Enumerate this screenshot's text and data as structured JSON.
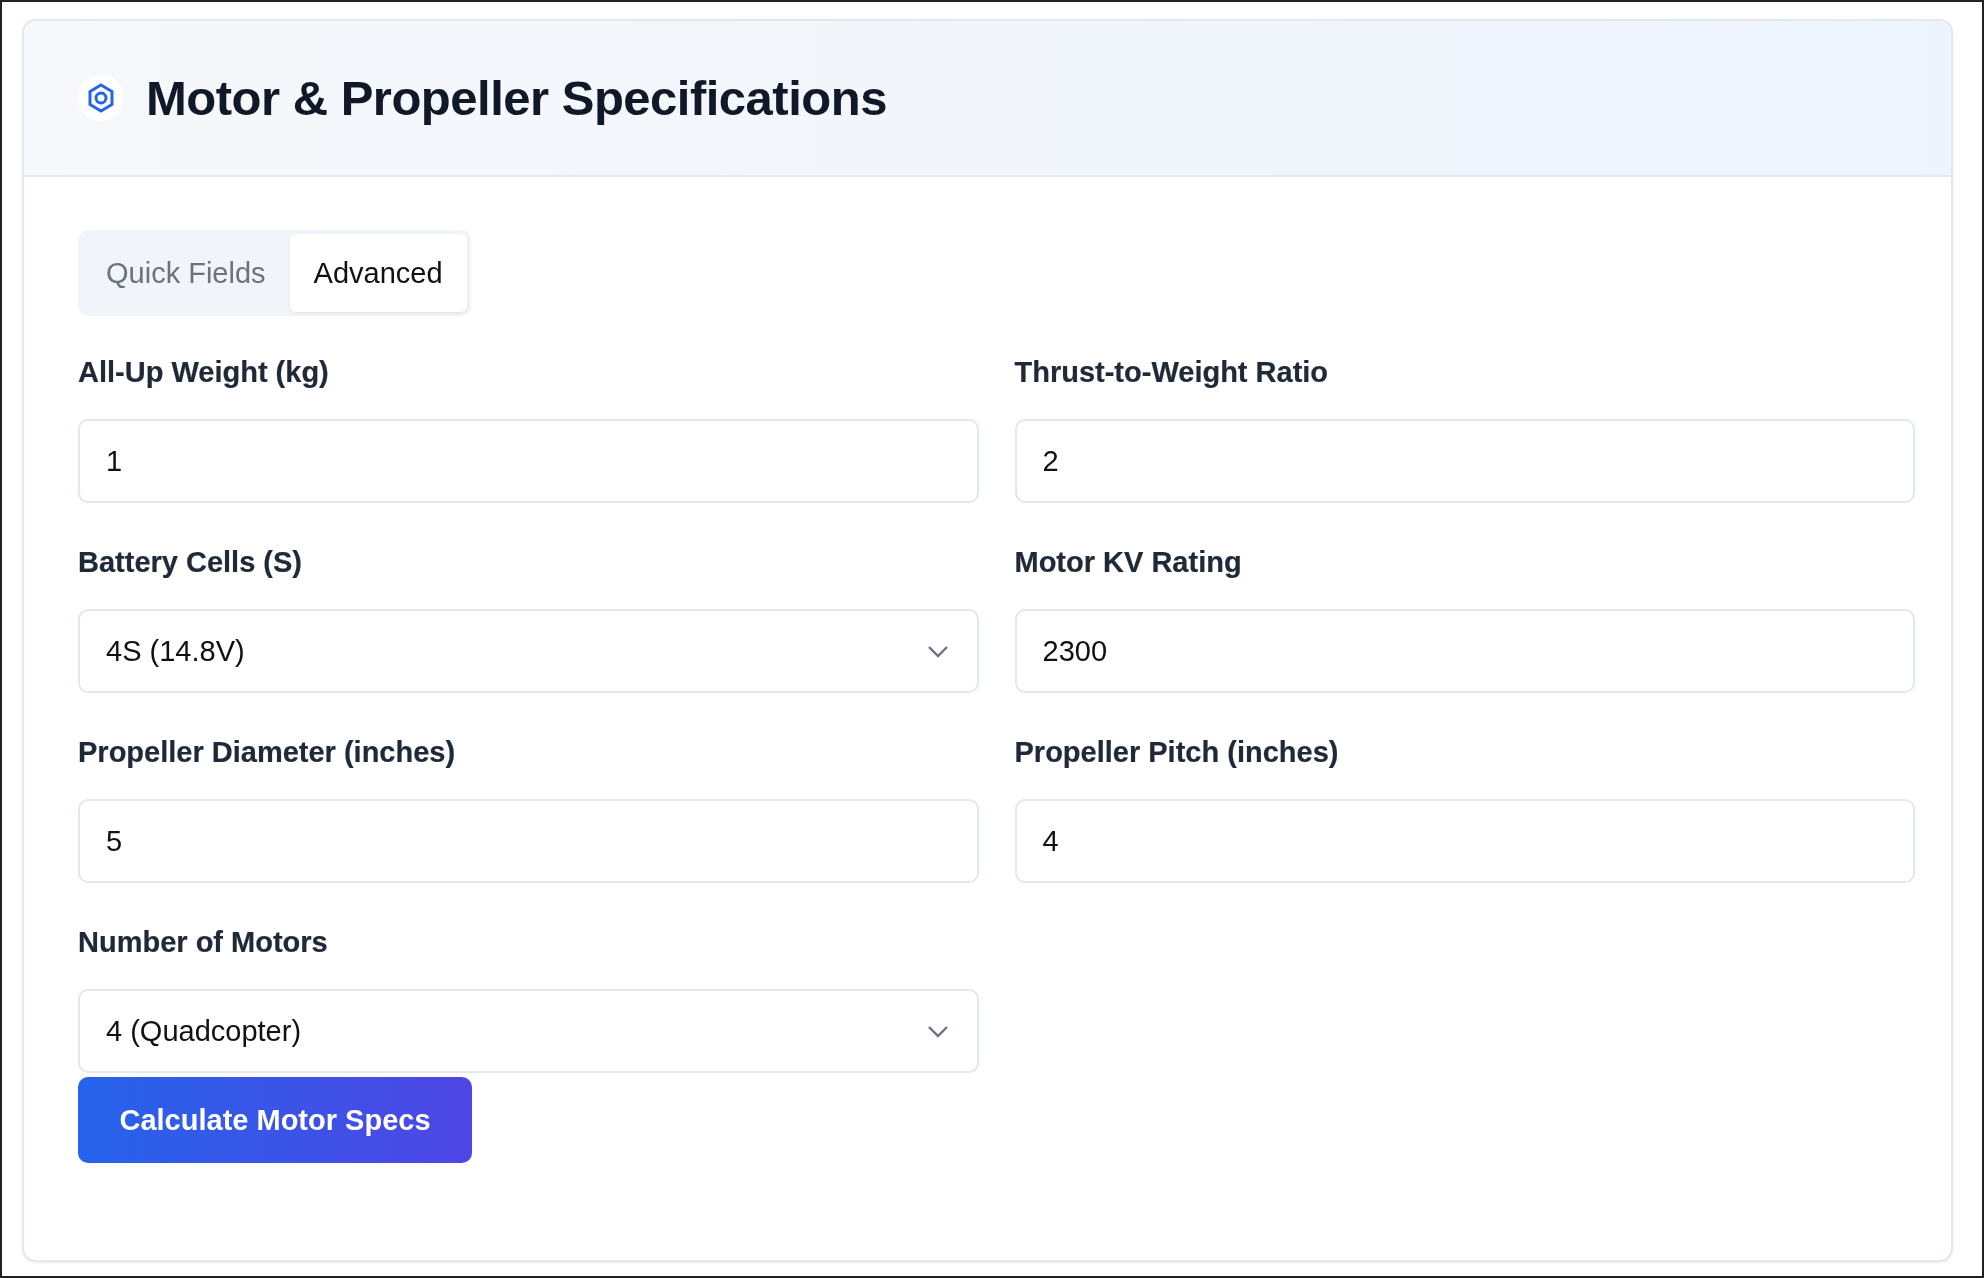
{
  "header": {
    "title": "Motor & Propeller Specifications"
  },
  "tabs": [
    {
      "label": "Quick Fields",
      "selected": false
    },
    {
      "label": "Advanced",
      "selected": true
    }
  ],
  "fields": [
    {
      "kind": "input",
      "label": "All-Up Weight (kg)",
      "value": "1"
    },
    {
      "kind": "input",
      "label": "Thrust-to-Weight Ratio",
      "value": "2"
    },
    {
      "kind": "select",
      "label": "Battery Cells (S)",
      "value": "4S (14.8V)"
    },
    {
      "kind": "input",
      "label": "Motor KV Rating",
      "value": "2300"
    },
    {
      "kind": "input",
      "label": "Propeller Diameter (inches)",
      "value": "5"
    },
    {
      "kind": "input",
      "label": "Propeller Pitch (inches)",
      "value": "4"
    },
    {
      "kind": "select",
      "label": "Number of Motors",
      "value": "4 (Quadcopter)"
    }
  ],
  "button": {
    "label": "Calculate Motor Specs"
  }
}
